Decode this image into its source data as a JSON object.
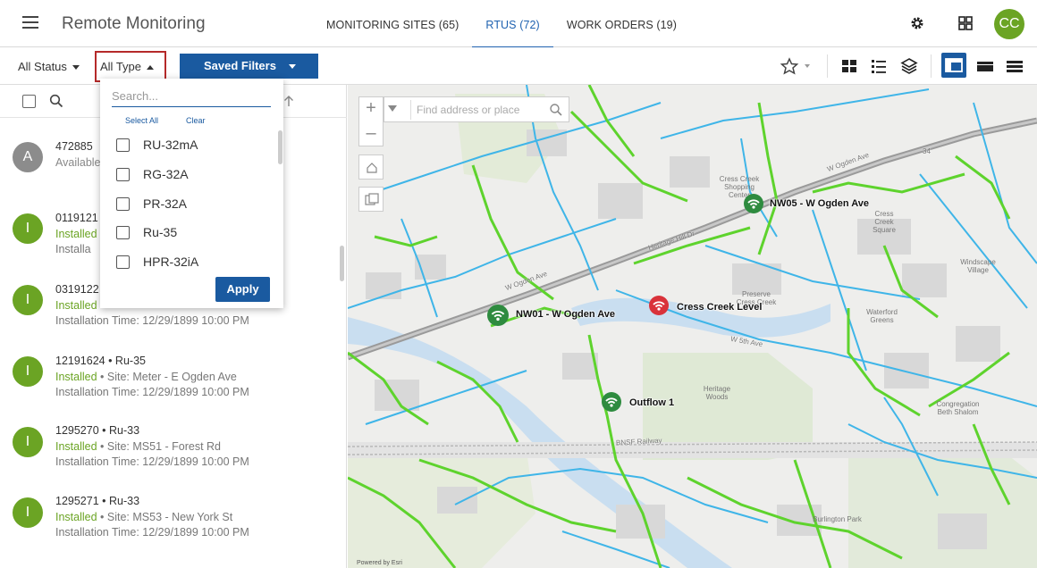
{
  "header": {
    "title": "Remote Monitoring",
    "tabs": [
      {
        "label": "MONITORING SITES (65)",
        "active": false
      },
      {
        "label": "RTUS (72)",
        "active": true
      },
      {
        "label": "WORK ORDERS (19)",
        "active": false
      }
    ],
    "user_initials": "CC",
    "accent": "#1a5aa0",
    "avatar_color": "#6ba424"
  },
  "filters": {
    "status_label": "All Status",
    "type_label": "All Type",
    "saved_filters_label": "Saved Filters"
  },
  "type_dropdown": {
    "search_placeholder": "Search...",
    "select_all": "Select All",
    "clear": "Clear",
    "options": [
      "RU-32mA",
      "RG-32A",
      "PR-32A",
      "Ru-35",
      "HPR-32iA"
    ],
    "apply_label": "Apply"
  },
  "rtu_list": [
    {
      "initial": "A",
      "color": "#8c8c8c",
      "line1": "472885",
      "status": "Available",
      "site": "",
      "install": ""
    },
    {
      "initial": "I",
      "color": "#6ba424",
      "line1": "0119121",
      "status": "Installed",
      "site": "",
      "install": "Installa"
    },
    {
      "initial": "I",
      "color": "#6ba424",
      "line1": "0319122",
      "status": "Installed",
      "site": "",
      "install": "Installation Time: 12/29/1899 10:00 PM"
    },
    {
      "initial": "I",
      "color": "#6ba424",
      "line1": "12191624 • Ru-35",
      "status": "Installed",
      "site": " • Site: Meter - E Ogden Ave",
      "install": "Installation Time: 12/29/1899 10:00 PM"
    },
    {
      "initial": "I",
      "color": "#6ba424",
      "line1": "1295270 • Ru-33",
      "status": "Installed",
      "site": " • Site: MS51 - Forest Rd",
      "install": "Installation Time: 12/29/1899 10:00 PM"
    },
    {
      "initial": "I",
      "color": "#6ba424",
      "line1": "1295271 • Ru-33",
      "status": "Installed",
      "site": " • Site: MS53 - New York St",
      "install": "Installation Time: 12/29/1899 10:00 PM"
    }
  ],
  "map": {
    "search_placeholder": "Find address or place",
    "site_labels": {
      "nw05": "NW05 - W Ogden Ave",
      "nw01": "NW01 - W Ogden Ave",
      "cress": "Cress Creek Level",
      "outflow": "Outflow 1"
    },
    "streets": {
      "ogden_right": "W Ogden Ave",
      "ogden_left": "W Ogden Ave",
      "heritage": "Heritage Hill Dr",
      "fifth": "W 5th Ave",
      "railway": "BNSF Railway",
      "route34": "34"
    },
    "pois": {
      "shopping": "Cress Creek Shopping Center",
      "square": "Cress Creek Square",
      "windscape": "Windscape Village",
      "preserve": "Preserve Cress Creek",
      "waterford": "Waterford Greens",
      "heritage_woods": "Heritage Woods",
      "congregation": "Congregation Beth Shalom",
      "burlington": "Burlington Park"
    },
    "attribution": "Powered by Esri"
  }
}
